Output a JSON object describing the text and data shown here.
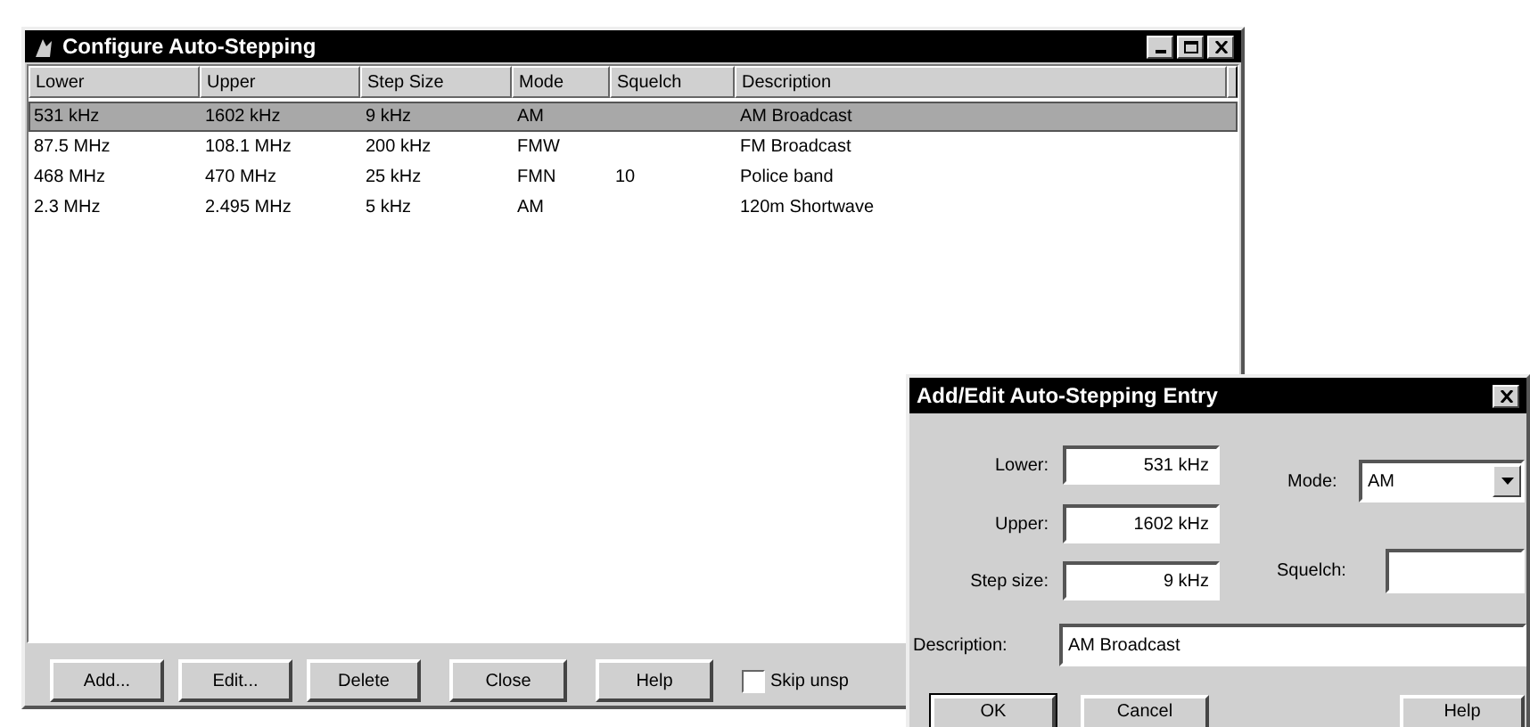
{
  "main_window": {
    "title": "Configure Auto-Stepping",
    "columns": [
      "Lower",
      "Upper",
      "Step Size",
      "Mode",
      "Squelch",
      "Description"
    ],
    "rows": [
      {
        "cells": [
          "531 kHz",
          "1602 kHz",
          "9 kHz",
          "AM",
          "",
          "AM Broadcast"
        ],
        "selected": true
      },
      {
        "cells": [
          "87.5 MHz",
          "108.1 MHz",
          "200 kHz",
          "FMW",
          "",
          "FM Broadcast"
        ],
        "selected": false
      },
      {
        "cells": [
          "468 MHz",
          "470 MHz",
          "25 kHz",
          "FMN",
          "10",
          "Police band"
        ],
        "selected": false
      },
      {
        "cells": [
          "2.3 MHz",
          "2.495 MHz",
          "5 kHz",
          "AM",
          "",
          "120m Shortwave"
        ],
        "selected": false
      }
    ],
    "buttons": [
      "Add...",
      "Edit...",
      "Delete",
      "Close",
      "Help"
    ],
    "checkbox": {
      "label": "Skip unsp",
      "checked": false
    }
  },
  "dialog": {
    "title": "Add/Edit Auto-Stepping Entry",
    "fields": [
      {
        "kind": "text",
        "label": "Lower:",
        "value": "531 kHz"
      },
      {
        "kind": "text",
        "label": "Upper:",
        "value": "1602 kHz"
      },
      {
        "kind": "text",
        "label": "Step size:",
        "value": "9 kHz"
      },
      {
        "kind": "select",
        "label": "Mode:",
        "value": "AM"
      },
      {
        "kind": "text",
        "label": "Squelch:"
      },
      {
        "kind": "wide",
        "label": "Description:",
        "value": "AM Broadcast"
      }
    ],
    "buttons": [
      "OK",
      "Cancel",
      "Help"
    ]
  }
}
